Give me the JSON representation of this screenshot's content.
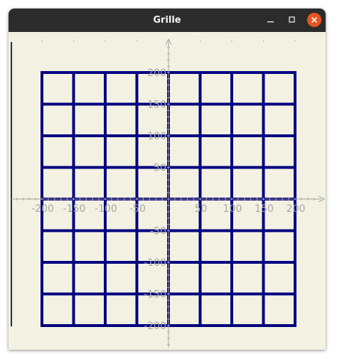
{
  "window": {
    "title": "Grille",
    "controls": {
      "minimize_icon": "minimize-icon",
      "maximize_icon": "maximize-icon",
      "close_icon": "close-icon"
    },
    "colors": {
      "titlebar": "#2c2c2c",
      "close_button": "#e95420",
      "canvas_bg": "#f3f2e2",
      "grid_line": "#000080",
      "axis": "#a6a6a6"
    }
  },
  "chart_data": {
    "type": "grid",
    "xlim": [
      -200,
      200
    ],
    "ylim": [
      -200,
      200
    ],
    "grid_step": 50,
    "x_tick_labels": [
      "-200",
      "-150",
      "-100",
      "-50",
      "50",
      "100",
      "150",
      "200"
    ],
    "y_tick_labels": [
      "200",
      "150",
      "100",
      "50",
      "-50",
      "-100",
      "-150",
      "-200"
    ],
    "x_ticks": [
      -200,
      -150,
      -100,
      -50,
      50,
      100,
      150,
      200
    ],
    "y_ticks": [
      200,
      150,
      100,
      50,
      -50,
      -100,
      -150,
      -200
    ],
    "line_color": "#000080"
  }
}
